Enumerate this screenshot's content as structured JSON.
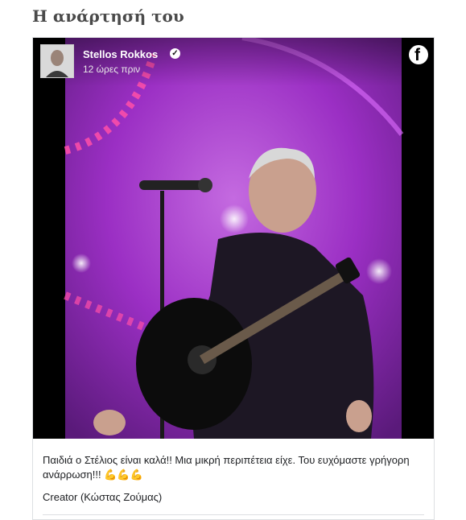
{
  "page": {
    "heading": "Η ανάρτησή του"
  },
  "post": {
    "author": "Stellos Rokkos",
    "verified_icon": "verified-badge-icon",
    "time": "12 ώρες πριν",
    "platform_icon": "facebook-icon",
    "caption": "Παιδιά ο Στέλιος είναι καλά!! Μια μικρή περιπέτεια είχε. Του ευχόμαστε γρήγορη ανάρρωση!!! 💪💪💪",
    "creator": "Creator (Κώστας Ζούμας)"
  },
  "colors": {
    "stage_purple": "#9b2fc4",
    "text": "#1c1e21",
    "heading": "#4a4a4a",
    "border": "#dddfe2"
  }
}
